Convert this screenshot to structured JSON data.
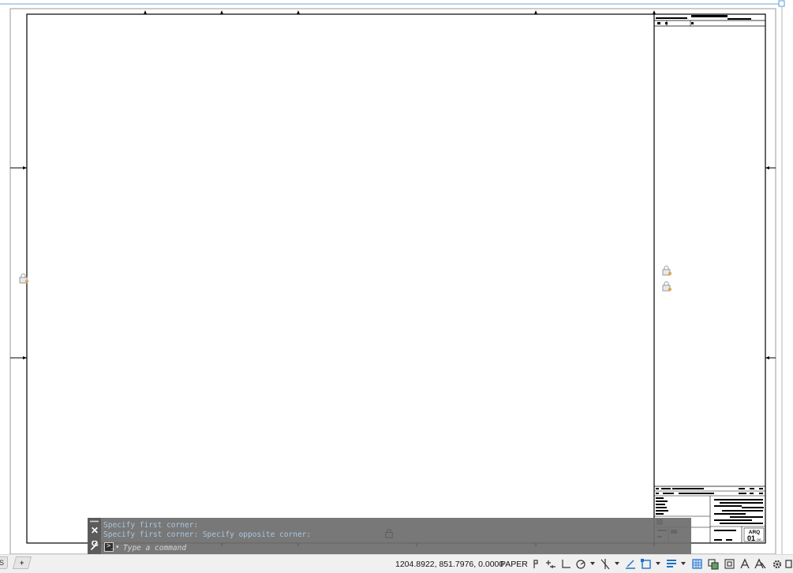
{
  "command_window": {
    "history": [
      "Specify first corner:",
      "Specify first corner: Specify opposite corner:"
    ],
    "input_placeholder": "Type a command",
    "close_label": "✕",
    "prompt_glyph": ">_"
  },
  "layout_tabs": {
    "partial_label": "S",
    "add_tab_label": "+"
  },
  "status_bar": {
    "coordinates": "1204.8922, 851.7976, 0.0000",
    "space": "PAPER",
    "icons": [
      "grid-snap-icon",
      "snap-mode-icon",
      "ortho-icon",
      "polar-tracking-icon",
      "isometric-icon",
      "object-snap-tracking-icon",
      "object-snap-icon",
      "lineweight-icon",
      "transparency-icon",
      "selection-cycling-icon",
      "annotation-scale-icon",
      "annotation-visibility-icon",
      "workspace-gear-icon",
      "customize-icon"
    ]
  },
  "title_block": {
    "discipline_code": "ARQ",
    "sheet_number": "01",
    "sheet_suffix": "DE"
  },
  "colors": {
    "drawing_background": "#ffffff",
    "frame_line": "#000000",
    "command_window_bg": "#6e6e6e",
    "command_history_text": "#a9c7e0",
    "status_bar_bg": "#f0f0f0",
    "accent_blue": "#1e6fc8"
  }
}
